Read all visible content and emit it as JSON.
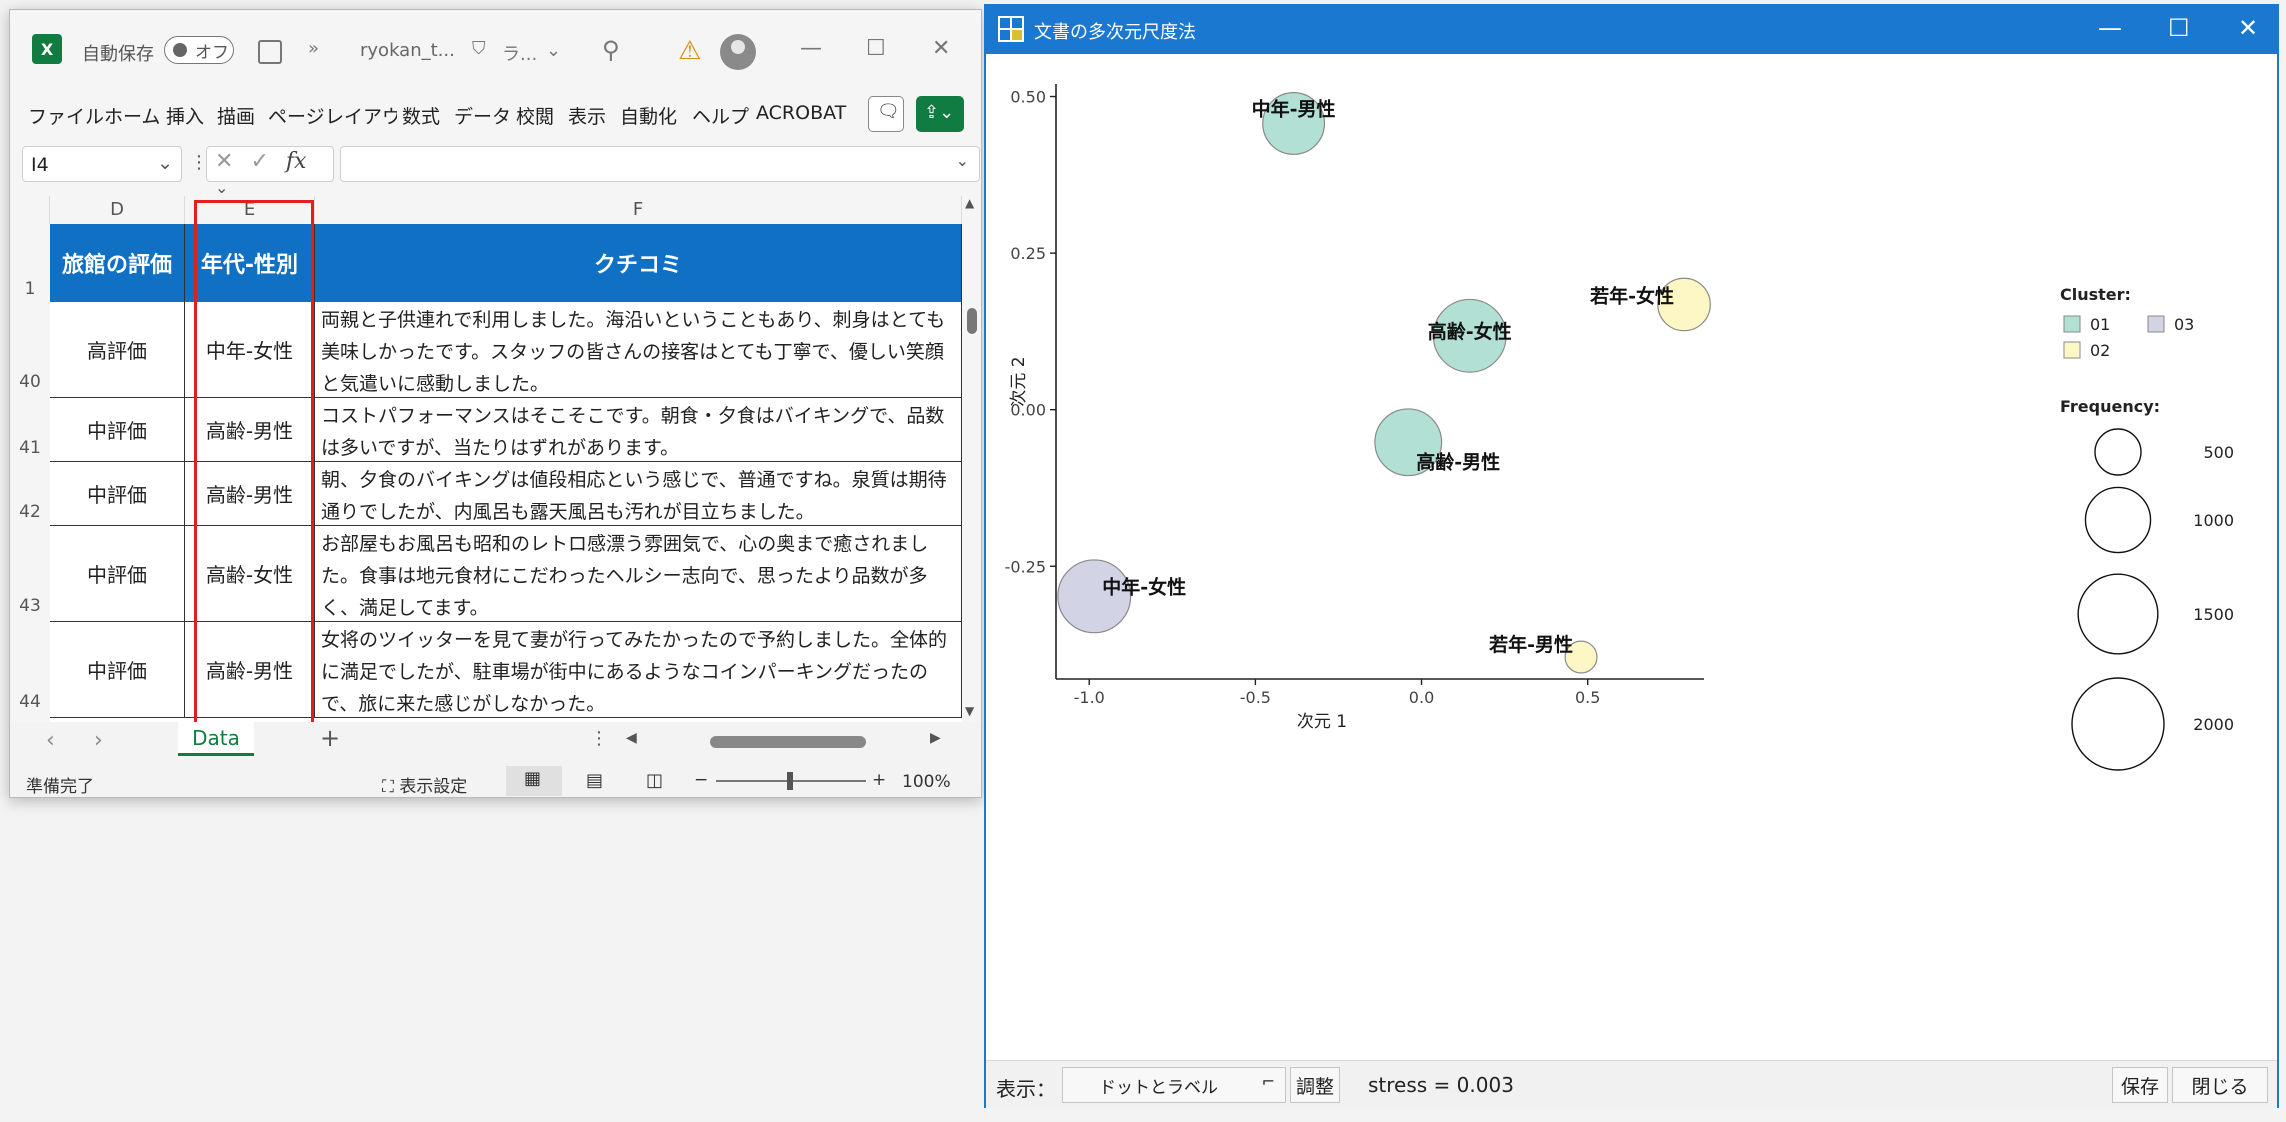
{
  "excel": {
    "autosave_label": "自動保存",
    "toggle_label": "オフ",
    "filename": "ryokan_t...",
    "sensitivity": "ラ...",
    "ribbon_tabs": [
      "ファイル",
      "ホーム",
      "挿入",
      "描画",
      "ページ",
      "レイアウト",
      "数式",
      "データ",
      "校閲",
      "表示",
      "自動化",
      "ヘルプ",
      "ACROBAT"
    ],
    "name_box": "I4",
    "fx_label": "fx",
    "columns": [
      "D",
      "E",
      "F"
    ],
    "header_row_num": "1",
    "headers": [
      "旅館の評価",
      "年代-性別",
      "クチコミ"
    ],
    "rows": [
      {
        "num": "40",
        "rating": "高評価",
        "demo": "中年-女性",
        "review": "両親と子供連れで利用しました。海沿いということもあり、刺身はとても美味しかったです。スタッフの皆さんの接客はとても丁寧で、優しい笑顔と気遣いに感動しました。"
      },
      {
        "num": "41",
        "rating": "中評価",
        "demo": "高齢-男性",
        "review": "コストパフォーマンスはそこそこです。朝食・夕食はバイキングで、品数は多いですが、当たりはずれがあります。"
      },
      {
        "num": "42",
        "rating": "中評価",
        "demo": "高齢-男性",
        "review": "朝、夕食のバイキングは値段相応という感じで、普通ですね。泉質は期待通りでしたが、内風呂も露天風呂も汚れが目立ちました。"
      },
      {
        "num": "43",
        "rating": "中評価",
        "demo": "高齢-女性",
        "review": "お部屋もお風呂も昭和のレトロ感漂う雰囲気で、心の奥まで癒されました。食事は地元食材にこだわったヘルシー志向で、思ったより品数が多く、満足してます。"
      },
      {
        "num": "44",
        "rating": "中評価",
        "demo": "高齢-男性",
        "review": "女将のツイッターを見て妻が行ってみたかったので予約しました。全体的に満足でしたが、駐車場が街中にあるようなコインパーキングだったので、旅に来た感じがしなかった。"
      }
    ],
    "sheet_tab": "Data",
    "add_sheet": "+",
    "status_ready": "準備完了",
    "display_settings": "表示設定",
    "zoom": "100%"
  },
  "mds": {
    "title": "文書の多次元尺度法",
    "display_label": "表示：",
    "display_value": "ドットとラベル",
    "adjust_button": "調整",
    "stress": "stress = 0.003",
    "save_button": "保存",
    "close_button": "閉じる"
  },
  "chart_data": {
    "type": "scatter",
    "xlabel": "次元 1",
    "ylabel": "次元 2",
    "xlim": [
      -1.1,
      0.85
    ],
    "ylim": [
      -0.43,
      0.52
    ],
    "xticks": [
      -1.0,
      -0.5,
      0.0,
      0.5
    ],
    "xtick_labels": [
      "-1.0",
      "-0.5",
      "0.0",
      "0.5"
    ],
    "yticks": [
      -0.25,
      0.0,
      0.25,
      0.5
    ],
    "ytick_labels": [
      "-0.25",
      "0.00",
      "0.25",
      "0.50"
    ],
    "grid": false,
    "points": [
      {
        "label": "中年-男性",
        "x": -0.385,
        "y": 0.457,
        "frequency": 900,
        "cluster": "01"
      },
      {
        "label": "高齢-女性",
        "x": 0.145,
        "y": 0.118,
        "frequency": 1250,
        "cluster": "01"
      },
      {
        "label": "高齢-男性",
        "x": -0.04,
        "y": -0.052,
        "frequency": 1050,
        "cluster": "01"
      },
      {
        "label": "若年-女性",
        "x": 0.79,
        "y": 0.168,
        "frequency": 650,
        "cluster": "02"
      },
      {
        "label": "若年-男性",
        "x": 0.48,
        "y": -0.395,
        "frequency": 240,
        "cluster": "02"
      },
      {
        "label": "中年-女性",
        "x": -0.985,
        "y": -0.298,
        "frequency": 1250,
        "cluster": "03"
      }
    ],
    "legend": {
      "cluster_title": "Cluster:",
      "clusters": [
        {
          "name": "01",
          "color": "#b3e0d4"
        },
        {
          "name": "02",
          "color": "#fdf7c6"
        },
        {
          "name": "03",
          "color": "#d3d3e6"
        }
      ],
      "frequency_title": "Frequency:",
      "frequencies": [
        {
          "label": "500",
          "value": 500
        },
        {
          "label": "1000",
          "value": 1000
        },
        {
          "label": "1500",
          "value": 1500
        },
        {
          "label": "2000",
          "value": 2000
        }
      ],
      "placement": "right"
    }
  }
}
